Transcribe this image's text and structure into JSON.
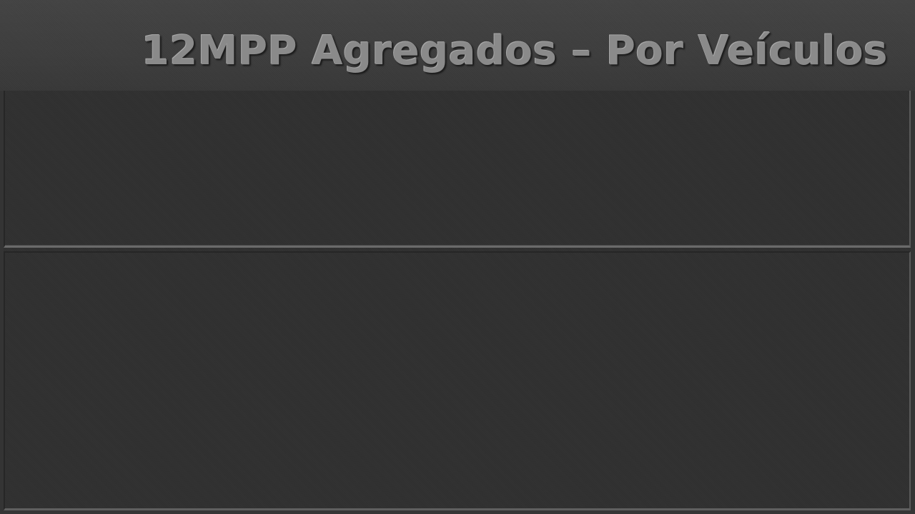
{
  "slide": {
    "title": "12MPP Agregados – Por Veículos"
  },
  "colors": {
    "background": "#303030",
    "title_bar": "#404040",
    "title_text": "#8a8a8a",
    "divider": "#6a6a6a"
  }
}
